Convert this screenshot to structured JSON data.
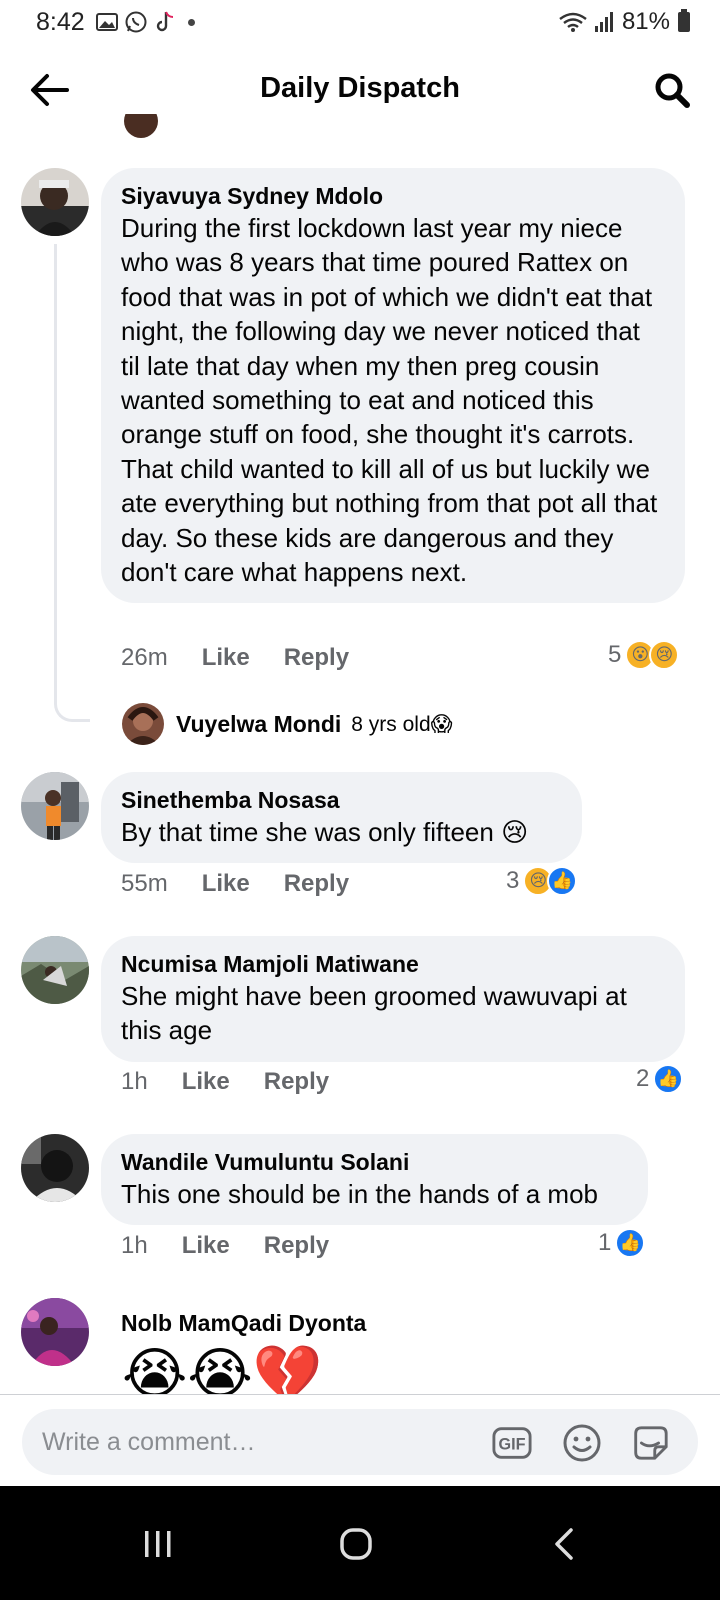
{
  "status_bar": {
    "time": "8:42",
    "battery": "81%",
    "left_icons": [
      "gallery-icon",
      "whatsapp-icon",
      "tiktok-icon",
      "dot-icon"
    ],
    "right_icons": [
      "wifi-icon",
      "signal-icon",
      "battery-icon"
    ]
  },
  "header": {
    "title": "Daily Dispatch",
    "back_icon": "arrow-left-icon",
    "search_icon": "search-icon"
  },
  "comments": [
    {
      "name": "Siyavuya Sydney Mdolo",
      "text": "During the first lockdown last year my niece who was 8 years that time poured Rattex on food that was in pot of which we didn't eat that night, the following day we never noticed that til late that day when my then preg cousin wanted something to eat and noticed this orange stuff on food, she thought it's carrots. That child wanted to kill all of us but luckily we ate everything but nothing from that pot all that day. So these kids are dangerous and they don't care what happens next.",
      "time": "26m",
      "like": "Like",
      "reply": "Reply",
      "reaction_count": "5",
      "reactions": [
        "😮",
        "😢"
      ]
    },
    {
      "name": "Sinethemba Nosasa",
      "text": "By that time she was only fifteen 😢",
      "time": "55m",
      "like": "Like",
      "reply": "Reply",
      "reaction_count": "3",
      "reactions": [
        "😢",
        "👍"
      ]
    },
    {
      "name": "Ncumisa Mamjoli Matiwane",
      "text": "She might have been groomed wawuvapi at this age",
      "time": "1h",
      "like": "Like",
      "reply": "Reply",
      "reaction_count": "2",
      "reactions": [
        "👍"
      ]
    },
    {
      "name": "Wandile Vumuluntu Solani",
      "text": "This one should be in the hands of a mob",
      "time": "1h",
      "like": "Like",
      "reply": "Reply",
      "reaction_count": "1",
      "reactions": [
        "👍"
      ]
    },
    {
      "name": "Nolb MamQadi Dyonta",
      "text": "😭😭💔"
    }
  ],
  "reply_preview": {
    "name": "Vuyelwa Mondi",
    "text": "8 yrs old😱"
  },
  "composer": {
    "placeholder": "Write a comment…",
    "gif_label": "GIF",
    "icons": [
      "gif-icon",
      "emoji-icon",
      "sticker-icon"
    ]
  },
  "colors": {
    "bubble": "#f0f2f5",
    "meta": "#65676b",
    "like_blue": "#1877f2",
    "reaction_yellow": "#f7b125"
  }
}
